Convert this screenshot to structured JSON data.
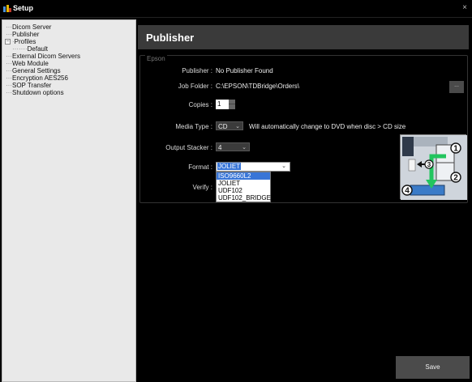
{
  "window": {
    "title": "Setup",
    "close_glyph": "×"
  },
  "sidebar": {
    "items": [
      {
        "label": "Dicom Server"
      },
      {
        "label": "Publisher"
      },
      {
        "label": "Profiles"
      },
      {
        "label": "Default"
      },
      {
        "label": "External Dicom Servers"
      },
      {
        "label": "Web Module"
      },
      {
        "label": "General Settings"
      },
      {
        "label": "Encryption AES256"
      },
      {
        "label": "SOP Transfer"
      },
      {
        "label": "Shutdown options"
      }
    ]
  },
  "main": {
    "title": "Publisher",
    "group_label": "Epson",
    "fields": {
      "publisher": {
        "label": "Publisher :",
        "value": "No Publisher Found"
      },
      "job_folder": {
        "label": "Job Folder :",
        "value": "C:\\EPSON\\TDBridge\\Orders\\",
        "browse_label": "..."
      },
      "copies": {
        "label": "Copies :",
        "value": "1"
      },
      "media_type": {
        "label": "Media Type :",
        "value": "CD",
        "note": "Will automatically change to DVD when disc > CD size"
      },
      "output_stacker": {
        "label": "Output Stacker :",
        "value": "4"
      },
      "format": {
        "label": "Format :",
        "value": "JOLIET",
        "options": [
          "ISO9660L2",
          "JOLIET",
          "UDF102",
          "UDF102_BRIDGE"
        ],
        "highlighted": "ISO9660L2"
      },
      "verify": {
        "label": "Verify :"
      }
    },
    "diagram_numbers": [
      "1",
      "2",
      "3",
      "4"
    ],
    "save_label": "Save"
  },
  "colors": {
    "background": "#000000",
    "header": "#3a3a3a",
    "sidebar": "#e9e9e9",
    "selection": "#3875d7",
    "arrow_green": "#22c55e"
  }
}
